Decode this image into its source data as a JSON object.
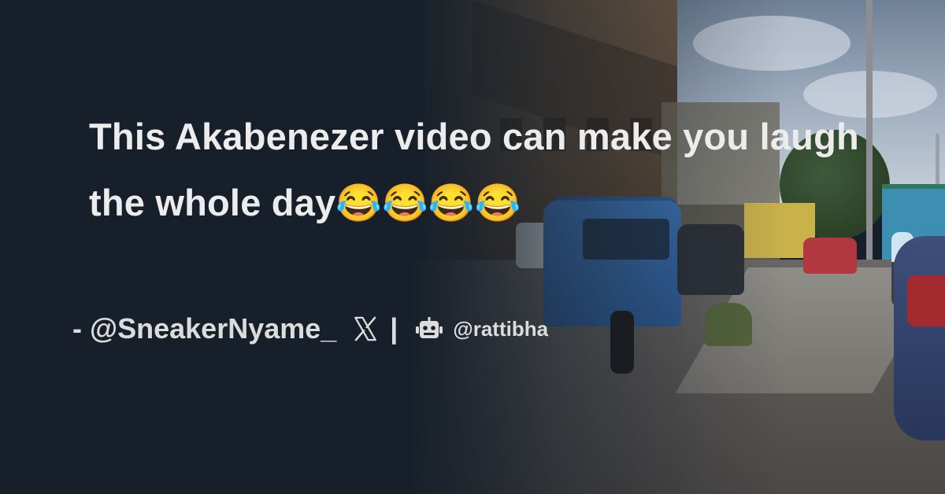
{
  "post": {
    "title": "This Akabenezer video can make you laugh the whole day😂😂😂😂",
    "author_prefix": "- ",
    "author_handle": "@SneakerNyame_",
    "separator": "|",
    "credit": "@rattibha"
  },
  "icons": {
    "platform": "x-logo-icon",
    "bot": "robot-icon"
  },
  "colors": {
    "background": "#17202a",
    "text": "#ececec"
  }
}
